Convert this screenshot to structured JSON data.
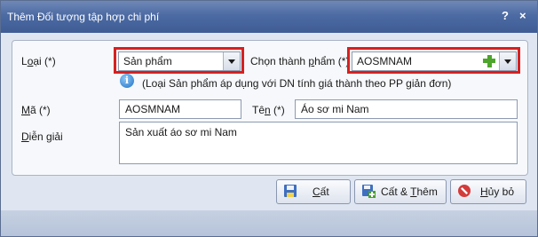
{
  "window": {
    "title": "Thêm Đối tượng tập hợp chi phí",
    "help": "?",
    "close": "×"
  },
  "form": {
    "loai_label_a": "L",
    "loai_label_u": "o",
    "loai_label_b": "ại (*)",
    "loai_value": "Sản phẩm",
    "chon_label_a": "Chọn thành ",
    "chon_label_u": "p",
    "chon_label_b": "hẩm (*)",
    "chon_value": "AOSMNAM",
    "info_text": "(Loại Sản phẩm áp dụng với DN tính giá thành theo PP giản đơn)",
    "ma_label_u": "M",
    "ma_label_b": "ã (*)",
    "ma_value": "AOSMNAM",
    "ten_label_a": "Tê",
    "ten_label_u": "n",
    "ten_label_b": " (*)",
    "ten_value": "Áo sơ mi Nam",
    "dien_label_u": "D",
    "dien_label_b": "iễn giải",
    "dien_value": "Sản xuất áo sơ mi Nam"
  },
  "buttons": {
    "cat_u": "C",
    "cat_b": "ất",
    "catthem_a": "Cất & ",
    "catthem_u": "T",
    "catthem_b": "hêm",
    "huy_u": "H",
    "huy_b": "ủy bỏ"
  },
  "icons": {
    "info": "info-icon",
    "add": "plus-icon",
    "save": "floppy-icon",
    "save_add": "floppy-add-icon",
    "cancel": "cancel-icon"
  },
  "colors": {
    "highlight": "#d62020",
    "title_bar": "#4c6aa3"
  }
}
